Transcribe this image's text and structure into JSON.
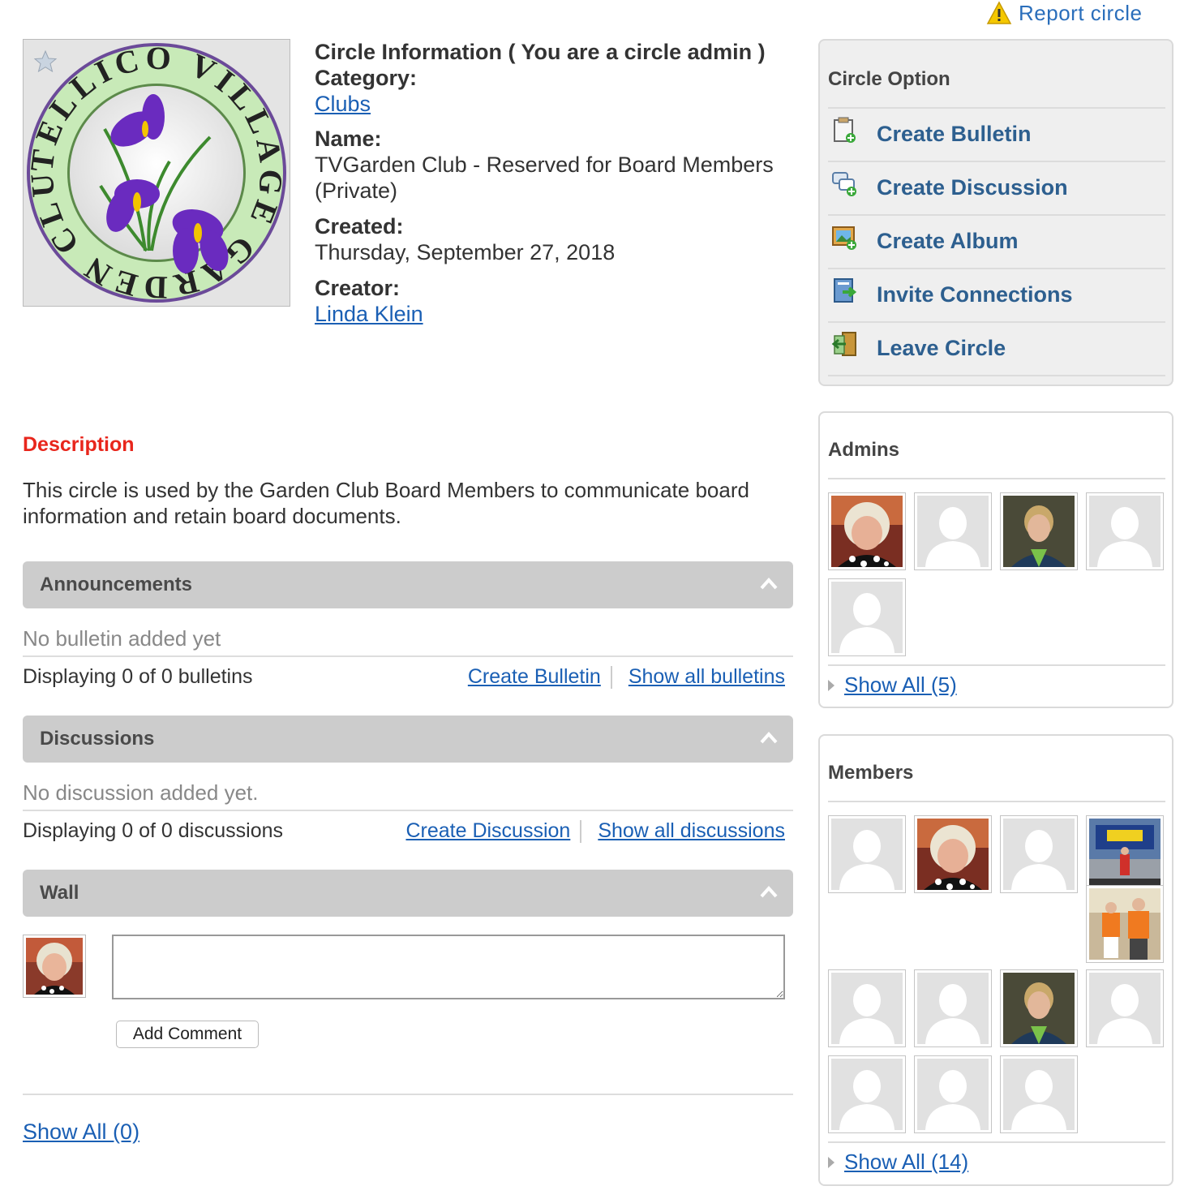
{
  "report": {
    "label": "Report  circle"
  },
  "info": {
    "heading": "Circle Information ( You are a circle admin )",
    "category_label": "Category:",
    "category_value": "Clubs",
    "name_label": "Name:",
    "name_value": "TVGarden Club - Reserved for Board Members",
    "name_privacy": "(Private)",
    "created_label": "Created:",
    "created_value": "Thursday, September 27, 2018",
    "creator_label": "Creator:",
    "creator_value": "Linda Klein"
  },
  "logo": {
    "text": "TELLICO VILLAGE GARDEN CLUB"
  },
  "description": {
    "title": "Description",
    "text": "This circle is used by the Garden Club Board Members to communicate board information and retain board documents."
  },
  "announcements": {
    "title": "Announcements",
    "empty": "No bulletin added yet",
    "count": "Displaying 0 of 0 bulletins",
    "create": "Create Bulletin ",
    "show_all": "Show all bulletins"
  },
  "discussions": {
    "title": "Discussions",
    "empty": "No discussion added yet.",
    "count": "Displaying 0 of 0 discussions",
    "create": "Create Discussion ",
    "show_all": "Show all discussions"
  },
  "wall": {
    "title": "Wall",
    "comment_value": "",
    "add_comment": "Add Comment",
    "show_all": "Show All (0)"
  },
  "circle_option": {
    "title": "Circle Option",
    "items": [
      {
        "label": "Create Bulletin",
        "icon": "bulletin-icon"
      },
      {
        "label": "Create Discussion",
        "icon": "discussion-icon"
      },
      {
        "label": "Create Album",
        "icon": "album-icon"
      },
      {
        "label": "Invite Connections",
        "icon": "invite-icon"
      },
      {
        "label": "Leave Circle",
        "icon": "leave-icon"
      }
    ]
  },
  "admins": {
    "title": "Admins",
    "avatars": [
      "photo-woman-white-hair",
      "placeholder",
      "photo-woman-short-hair",
      "placeholder",
      "placeholder"
    ],
    "show_all": "Show All (5)"
  },
  "members": {
    "title": "Members",
    "avatars": [
      "placeholder",
      "photo-woman-white-hair",
      "placeholder",
      "photo-racetrack",
      "photo-orange-couple",
      "placeholder",
      "placeholder",
      "photo-woman-short-hair",
      "placeholder",
      "placeholder",
      "placeholder",
      "placeholder"
    ],
    "show_all": "Show All (14)"
  },
  "colors": {
    "link": "#1a5fb4",
    "description_title": "#e8261c",
    "option_label": "#2d5f8f",
    "bar_bg": "#cccccc",
    "logo_ring": "#c8eab8",
    "logo_border": "#6b4a99"
  }
}
